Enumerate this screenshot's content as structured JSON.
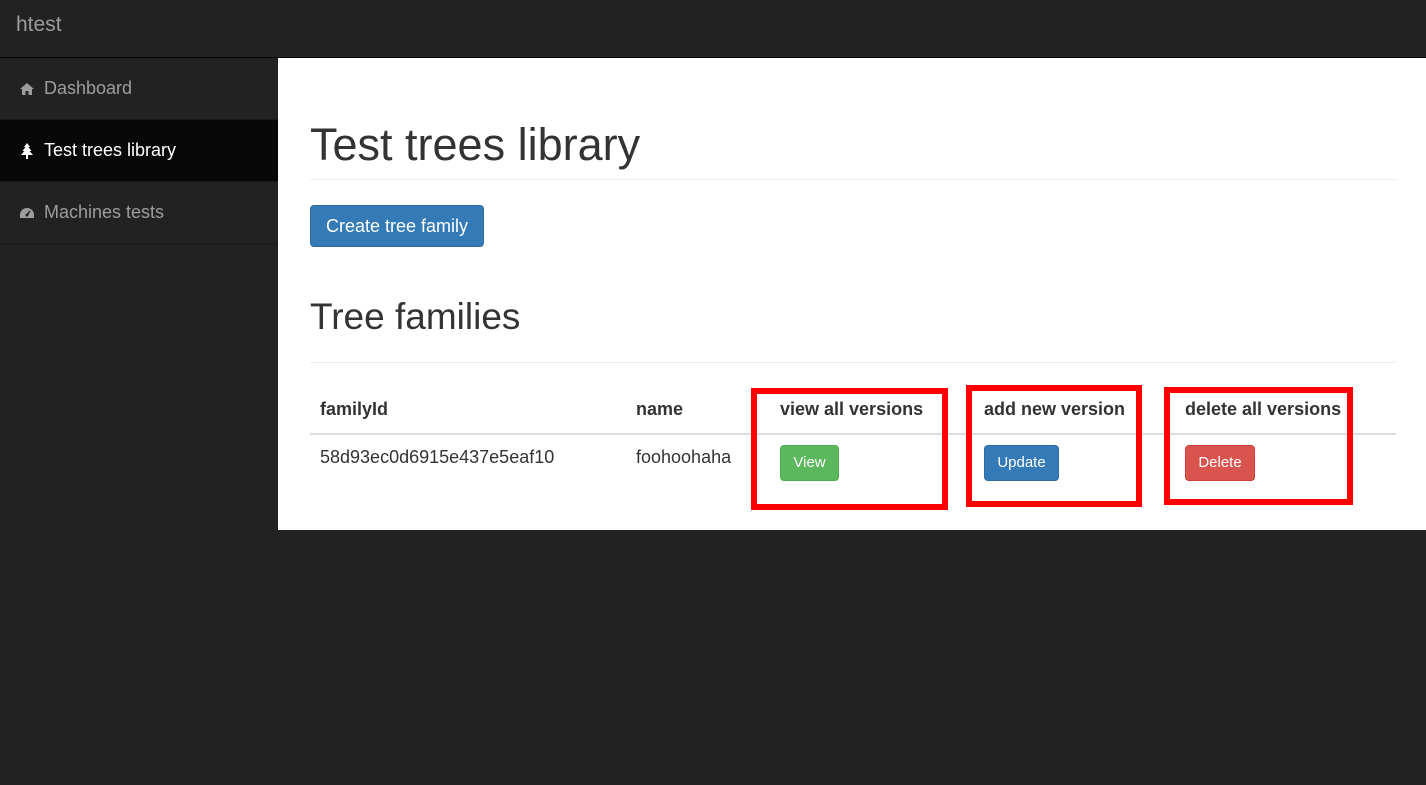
{
  "navbar": {
    "brand": "htest"
  },
  "sidebar": {
    "items": [
      {
        "label": "Dashboard",
        "icon": "home-icon",
        "active": false
      },
      {
        "label": "Test trees library",
        "icon": "tree-icon",
        "active": true
      },
      {
        "label": "Machines tests",
        "icon": "dashboard-gauge-icon",
        "active": false
      }
    ]
  },
  "main": {
    "title": "Test trees library",
    "create_button": "Create tree family",
    "section_title": "Tree families",
    "table": {
      "headers": [
        "familyId",
        "name",
        "view all versions",
        "add new version",
        "delete all versions"
      ],
      "rows": [
        {
          "familyId": "58d93ec0d6915e437e5eaf10",
          "name": "foohoohaha",
          "view": "View",
          "update": "Update",
          "delete": "Delete"
        }
      ]
    }
  },
  "colors": {
    "primary": "#337ab7",
    "success": "#5cb85c",
    "danger": "#d9534f",
    "highlight": "#ff0000",
    "chrome": "#222222"
  }
}
